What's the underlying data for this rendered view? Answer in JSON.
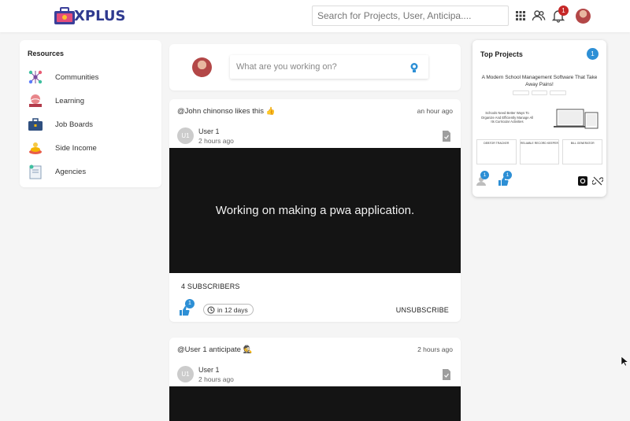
{
  "header": {
    "logo_text": "XPLUS",
    "search_placeholder": "Search for Projects, User, Anticipa....",
    "notification_count": "1"
  },
  "resources": {
    "title": "Resources",
    "items": [
      {
        "label": "Communities",
        "icon": "communities-icon"
      },
      {
        "label": "Learning",
        "icon": "learning-icon"
      },
      {
        "label": "Job Boards",
        "icon": "briefcase-icon"
      },
      {
        "label": "Side Income",
        "icon": "side-income-icon"
      },
      {
        "label": "Agencies",
        "icon": "agencies-icon"
      }
    ]
  },
  "composer": {
    "placeholder": "What are you working on?"
  },
  "posts": [
    {
      "activity": "@John chinonso  likes this 👍",
      "time": "an hour ago",
      "user_initials": "U1",
      "user_name": "User 1",
      "user_time": "2 hours ago",
      "media_text": "Working on making a pwa application.",
      "subscribers": "4 SUBSCRIBERS",
      "like_count": "1",
      "deadline": "in 12 days",
      "action": "UNSUBSCRIBE"
    },
    {
      "activity": "@User 1  anticipate 🕵",
      "time": "2 hours ago",
      "user_initials": "U1",
      "user_name": "User 1",
      "user_time": "2 hours ago"
    }
  ],
  "top_projects": {
    "title": "Top Projects",
    "count": "1",
    "thumb_heading": "A Modern School Management Software That Take Away Pains!",
    "thumb_sub": "Schools Need Better Ways To Organize And Efficiently Manage All Its Curricular Activities",
    "thumb_cards": [
      "DEBTOR TRACKER",
      "RELIABLE RECORD KEEPER",
      "BILL GENERATOR"
    ],
    "subscriber_count": "1",
    "like_count": "1"
  },
  "colors": {
    "accent": "#2d8fd5",
    "badge_red": "#c62828",
    "logo_blue": "#2f3a8f"
  }
}
